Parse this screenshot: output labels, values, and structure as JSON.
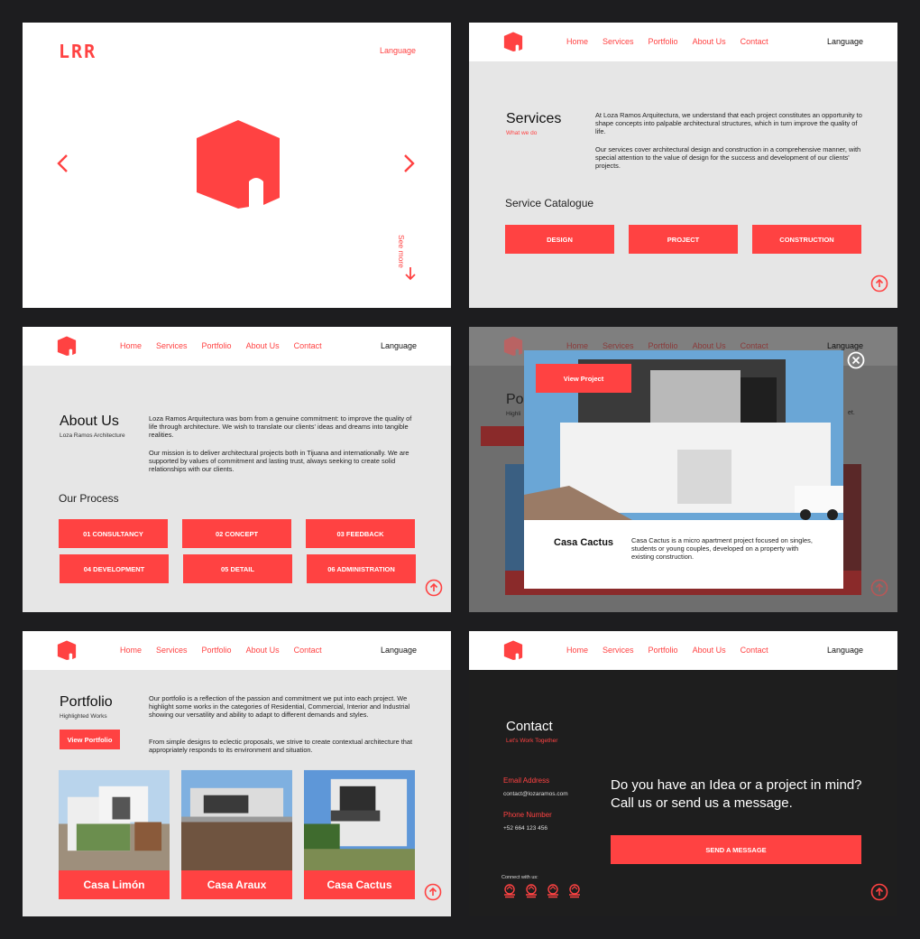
{
  "brand": {
    "logo_text": "LRR",
    "accent": "#ff4242",
    "dark": "#1e1e1e",
    "light": "#e6e6e6"
  },
  "nav": {
    "home": "Home",
    "services": "Services",
    "portfolio": "Portfolio",
    "about": "About Us",
    "contact": "Contact",
    "language": "Language"
  },
  "hero": {
    "language": "Language",
    "see_more": "See more"
  },
  "services": {
    "title": "Services",
    "subtitle": "What we do",
    "p1": "At Loza Ramos Arquitectura, we understand that each project constitutes an opportunity to shape concepts into palpable architectural structures, which in turn improve the quality of life.",
    "p2": "Our services cover architectural design and construction in a comprehensive manner, with special attention to the value of design for the success and development of our clients' projects.",
    "catalogue_title": "Service Catalogue",
    "buttons": [
      "DESIGN",
      "PROJECT",
      "CONSTRUCTION"
    ]
  },
  "about": {
    "title": "About Us",
    "subtitle": "Loza Ramos Architecture",
    "p1": "Loza Ramos Arquitectura was born from a genuine commitment: to improve the quality of life through architecture. We wish to translate our clients' ideas and dreams into tangible realities.",
    "p2": "Our mission is to deliver architectural projects both in Tijuana and internationally. We are supported by values of commitment and lasting trust, always seeking to create solid relationships with our clients.",
    "process_title": "Our Process",
    "steps": [
      "01 CONSULTANCY",
      "02 CONCEPT",
      "03 FEEDBACK",
      "04 DEVELOPMENT",
      "05 DETAIL",
      "06 ADMINISTRATION"
    ]
  },
  "modal": {
    "view_project": "View Project",
    "title": "Casa Cactus",
    "text": "Casa Cactus is a micro apartment project focused on singles, students or young couples, developed on a property with existing construction.",
    "bg_title": "Po",
    "bg_sub": "Highli",
    "bg_et": "et."
  },
  "portfolio": {
    "title": "Portfolio",
    "subtitle": "Highlighted Works",
    "p1": "Our portfolio is a reflection of the passion and commitment we put into each project. We highlight some works in the categories of Residential, Commercial, Interior and Industrial showing our versatility and ability to adapt to different demands and styles.",
    "p2": "From simple designs to eclectic proposals, we strive to create contextual architecture that appropriately responds to its environment and situation.",
    "view_button": "View Portfolio",
    "items": [
      "Casa Limón",
      "Casa Araux",
      "Casa Cactus"
    ]
  },
  "contact": {
    "title": "Contact",
    "subtitle": "Let's Work Together",
    "email_label": "Email Address",
    "email_value": "contact@lozaramos.com",
    "phone_label": "Phone Number",
    "phone_value": "+52 664 123 456",
    "connect": "Connect with us:",
    "headline": "Do you have an Idea or a project in mind? Call us or send us a message.",
    "send_button": "SEND A MESSAGE"
  }
}
